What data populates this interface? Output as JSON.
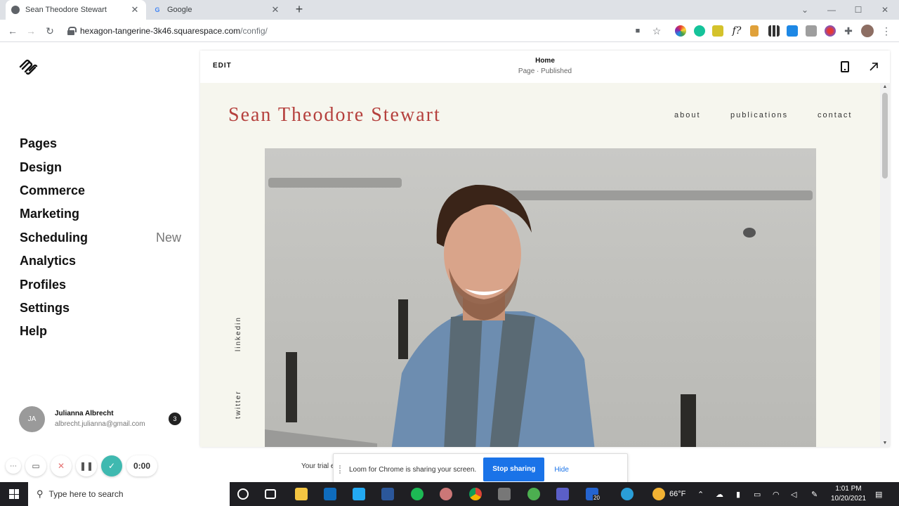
{
  "browser": {
    "tabs": [
      {
        "title": "Sean Theodore Stewart",
        "active": true,
        "icon": "globe-icon"
      },
      {
        "title": "Google",
        "active": false,
        "icon": "google-icon"
      }
    ],
    "url": {
      "host": "hexagon-tangerine-3k46.squarespace.com",
      "path": "/config/"
    }
  },
  "sidebar": {
    "items": [
      {
        "label": "Pages"
      },
      {
        "label": "Design"
      },
      {
        "label": "Commerce"
      },
      {
        "label": "Marketing"
      },
      {
        "label": "Scheduling",
        "badge": "New"
      },
      {
        "label": "Analytics"
      },
      {
        "label": "Profiles"
      },
      {
        "label": "Settings"
      },
      {
        "label": "Help"
      }
    ],
    "account": {
      "initials": "JA",
      "name": "Julianna Albrecht",
      "email": "albrecht.julianna@gmail.com",
      "notifications": "3"
    }
  },
  "editor": {
    "edit_label": "EDIT",
    "page_title": "Home",
    "page_status": "Page · Published"
  },
  "site": {
    "title": "Sean Theodore Stewart",
    "nav": {
      "about": "about",
      "publications": "publications",
      "contact": "contact"
    },
    "social": {
      "linkedin": "linkedin",
      "twitter": "twitter"
    }
  },
  "loom": {
    "timer": "0:00",
    "trial_text": "Your trial e",
    "share_message": "Loom for Chrome is sharing your screen.",
    "stop_label": "Stop sharing",
    "hide_label": "Hide"
  },
  "taskbar": {
    "search_placeholder": "Type here to search",
    "temperature": "66°F",
    "time": "1:01 PM",
    "date": "10/20/2021",
    "teams_badge": "20"
  },
  "colors": {
    "site_title": "#b5403d",
    "site_bg": "#f6f6ee",
    "loom_accent": "#3fb9b0",
    "share_button": "#1a73e8"
  }
}
